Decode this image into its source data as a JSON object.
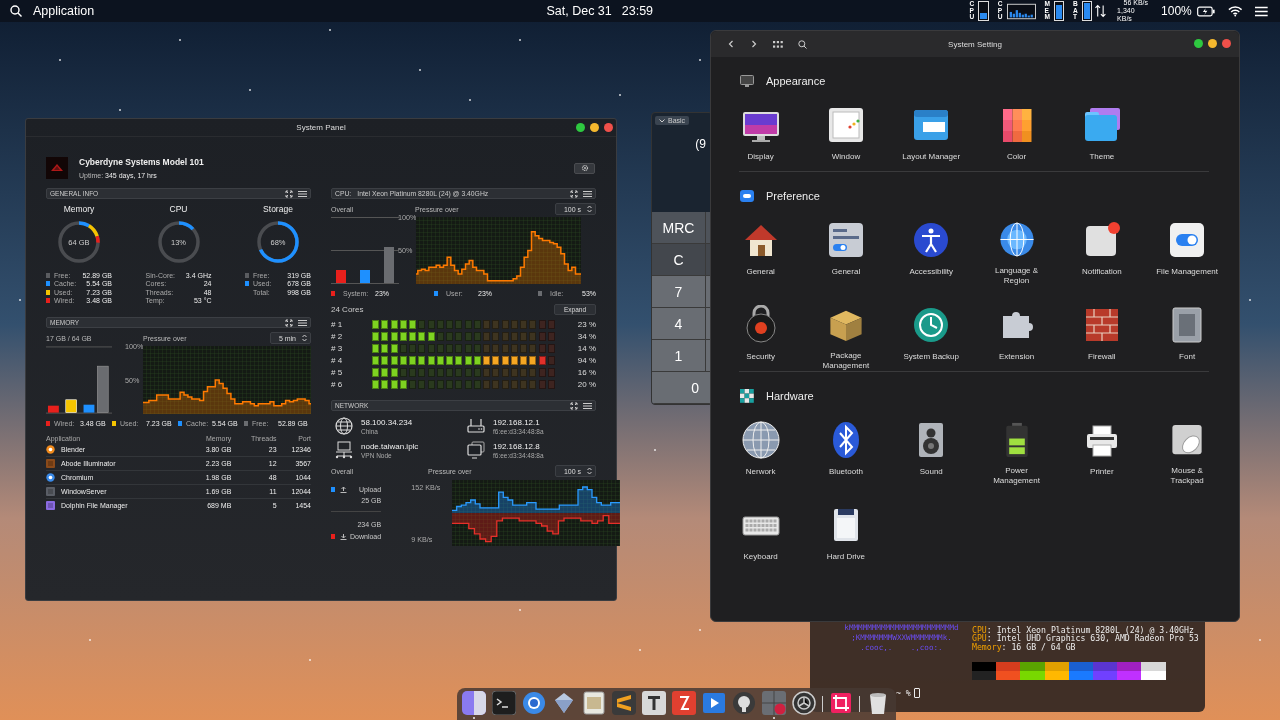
{
  "menu_bar": {
    "app_name": "Application",
    "date": "Sat, Dec 31",
    "time": "23:59",
    "monitors": [
      {
        "label": "CPU",
        "kind": "bar",
        "level": 0.35
      },
      {
        "label": "CPU",
        "kind": "graph"
      },
      {
        "label": "MEM",
        "kind": "bar",
        "level": 0.85
      },
      {
        "label": "BAT",
        "kind": "bar",
        "level": 1
      }
    ],
    "upload_rate": "56 KB/s",
    "download_rate": "1,340 KB/s",
    "battery": "100%"
  },
  "system_panel": {
    "title": "System Panel",
    "machine": "Cyberdyne Systems Model 101",
    "uptime_label": "Uptime:",
    "uptime": "345 days, 17 hrs",
    "general_info": {
      "title": "GENERAL INFO",
      "gauges": [
        {
          "title": "Memory",
          "center": "64 GB",
          "segments": [
            {
              "color": "#1e90ff",
              "level": 0.087
            },
            {
              "color": "#f5c400",
              "level": 0.113
            },
            {
              "color": "#e8201c",
              "level": 0.054
            }
          ],
          "legend": [
            {
              "label": "Free:",
              "value": "52.89 GB",
              "color": "#5a5c60"
            },
            {
              "label": "Cache:",
              "value": "5.54 GB",
              "color": "#1e90ff"
            },
            {
              "label": "Used:",
              "value": "7.23 GB",
              "color": "#f5c400"
            },
            {
              "label": "Wired:",
              "value": "3.48 GB",
              "color": "#e8201c"
            }
          ]
        },
        {
          "title": "CPU",
          "center": "13%",
          "segments": [
            {
              "color": "#1e90ff",
              "level": 0.13
            }
          ],
          "legend": [
            {
              "label": "Sin-Core:",
              "value": "3.4 GHz"
            },
            {
              "label": "Cores:",
              "value": "24"
            },
            {
              "label": "Threads:",
              "value": "48"
            },
            {
              "label": "Temp:",
              "value": "53 °C"
            }
          ]
        },
        {
          "title": "Storage",
          "center": "68%",
          "segments": [
            {
              "color": "#1e90ff",
              "level": 0.68
            }
          ],
          "legend": [
            {
              "label": "Free:",
              "value": "319 GB",
              "color": "#5a5c60"
            },
            {
              "label": "Used:",
              "value": "678 GB",
              "color": "#1e90ff"
            },
            {
              "label": "Total:",
              "value": "998 GB"
            }
          ]
        }
      ]
    },
    "memory": {
      "title": "MEMORY",
      "summary": "17 GB / 64 GB",
      "pressure_label": "Pressure over",
      "range": "5 min",
      "chart_data": {
        "type": "area",
        "ylim": [
          0,
          100
        ],
        "yticks": [
          {
            "value": 50,
            "label": "50%"
          },
          {
            "value": 100,
            "label": "100%"
          }
        ],
        "series": [
          {
            "color": "#ff7a00",
            "values": [
              17,
              17,
              20,
              20,
              28,
              28,
              28,
              22,
              22,
              22,
              32,
              28,
              25,
              22,
              22,
              20,
              33,
              40,
              40,
              50,
              45,
              38,
              30,
              22,
              15,
              15,
              18,
              18,
              15,
              12,
              15,
              15,
              15,
              18,
              12,
              12,
              15,
              20,
              18,
              20,
              22,
              22,
              20,
              15
            ]
          }
        ]
      },
      "legend": [
        {
          "label": "Wired:",
          "value": "3.48 GB",
          "color": "#e8201c"
        },
        {
          "label": "Used:",
          "value": "7.23 GB",
          "color": "#f5c400"
        },
        {
          "label": "Cache:",
          "value": "5.54 GB",
          "color": "#1e90ff"
        },
        {
          "label": "Free:",
          "value": "52.89 GB",
          "color": "#6a6c70"
        }
      ],
      "table": {
        "columns": [
          "Application",
          "Memory",
          "Threads",
          "Port"
        ],
        "rows": [
          [
            "Blender",
            "3.80 GB",
            "23",
            "12346"
          ],
          [
            "Abode Illuminator",
            "2.23 GB",
            "12",
            "3567"
          ],
          [
            "Chromium",
            "1.98 GB",
            "48",
            "1044"
          ],
          [
            "WindowServer",
            "1.69 GB",
            "11",
            "12044"
          ],
          [
            "Dolphin File Manager",
            "689 MB",
            "5",
            "1454"
          ]
        ]
      }
    },
    "cpu": {
      "label": "CPU:",
      "model": "Intel Xeon Platinum 8280L (24) @ 3.40GHz",
      "overall_label": "Overall",
      "pressure_label": "Pressure over",
      "range": "100 s",
      "chart_data": {
        "type": "area",
        "ylim": [
          0,
          100
        ],
        "yticks": [
          {
            "value": 50,
            "label": "50%"
          },
          {
            "value": 100,
            "label": "100%"
          }
        ],
        "series": [
          {
            "color": "#ff7a00",
            "values": [
              15,
              20,
              22,
              20,
              25,
              25,
              28,
              25,
              28,
              40,
              28,
              20,
              15,
              22,
              30,
              35,
              25,
              20,
              20,
              15,
              5,
              5,
              5,
              5,
              5,
              5,
              5,
              8,
              12,
              25,
              40,
              50,
              78,
              72,
              68,
              65,
              65,
              62,
              60,
              55,
              45,
              30,
              20,
              25,
              15,
              15
            ]
          }
        ]
      },
      "legend": [
        {
          "label": "System:",
          "value": "23%",
          "color": "#e8201c"
        },
        {
          "label": "User:",
          "value": "23%",
          "color": "#1e90ff"
        },
        {
          "label": "Idle:",
          "value": "53%",
          "color": "#6a6c70"
        }
      ],
      "cores_title": "24 Cores",
      "expand": "Expand",
      "cores": [
        {
          "label": "# 1",
          "level": 0.23,
          "reading": "23 %"
        },
        {
          "label": "# 2",
          "level": 0.34,
          "reading": "34 %"
        },
        {
          "label": "# 3",
          "level": 0.14,
          "reading": "14 %"
        },
        {
          "label": "# 4",
          "level": 0.94,
          "reading": "94 %"
        },
        {
          "label": "# 5",
          "level": 0.16,
          "reading": "16 %"
        },
        {
          "label": "# 6",
          "level": 0.2,
          "reading": "20 %"
        }
      ]
    },
    "network": {
      "title": "NETWORK",
      "endpoints": [
        {
          "address": "58.100.34.234",
          "detail": "China"
        },
        {
          "address": "192.168.12.1",
          "detail": "f6:ee:d3:34:48:8a"
        },
        {
          "address": "node.taiwan.iplc",
          "detail": "VPN Node"
        },
        {
          "address": "192.168.12.8",
          "detail": "f6:ee:d3:34:48:8a"
        }
      ],
      "overall_label": "Overall",
      "pressure_label": "Pressure over",
      "range": "100 s",
      "upload_label": "Upload",
      "upload_total": "25 GB",
      "download_total": "234 GB",
      "download_label": "Download",
      "top_label": "152 KB/s",
      "bottom_label": "9 KB/s"
    }
  },
  "calculator": {
    "mode": "Basic",
    "display": "(9",
    "keys": [
      {
        "label": "MRC",
        "kind": "memory"
      },
      {
        "label": "C",
        "kind": "function"
      },
      {
        "label": "7",
        "kind": "digit"
      },
      {
        "label": "4",
        "kind": "digit"
      },
      {
        "label": "1",
        "kind": "digit"
      },
      {
        "label": "0",
        "kind": "digit"
      }
    ]
  },
  "system_setting": {
    "title": "System Setting",
    "sections": [
      {
        "title": "Appearance",
        "items": [
          {
            "label": "Display"
          },
          {
            "label": "Window"
          },
          {
            "label": "Layout Manager"
          },
          {
            "label": "Color"
          },
          {
            "label": "Theme"
          }
        ]
      },
      {
        "title": "Preference",
        "items": [
          {
            "label": "General"
          },
          {
            "label": "General"
          },
          {
            "label": "Accessibility"
          },
          {
            "label": "Language & Region"
          },
          {
            "label": "Notification"
          },
          {
            "label": "File Management"
          },
          {
            "label": "Security"
          },
          {
            "label": "Package Management"
          },
          {
            "label": "System Backup"
          },
          {
            "label": "Extension"
          },
          {
            "label": "Firewall"
          },
          {
            "label": "Font"
          }
        ]
      },
      {
        "title": "Hardware",
        "items": [
          {
            "label": "Nerwork"
          },
          {
            "label": "Bluetooth"
          },
          {
            "label": "Sound"
          },
          {
            "label": "Power Management"
          },
          {
            "label": "Printer"
          },
          {
            "label": "Mouse & Trackpad"
          },
          {
            "label": "Keyboard"
          },
          {
            "label": "Hard Drive"
          }
        ]
      }
    ]
  },
  "terminal": {
    "art": [
      "kMMMMMMMMMMMMMMMMMMMMMMMd",
      ";KMMMMMMMWXXWMMMMMMMk.",
      ".cooc,.    .,coo:."
    ],
    "info": [
      {
        "label": "CPU",
        "value": ": Intel Xeon Platinum 8280L (24) @ 3.40GHz"
      },
      {
        "label": "GPU",
        "value": ": Intel UHD Graphics 630, AMD Radeon Pro 53"
      },
      {
        "label": "Memory",
        "value": ": 16 GB / 64 GB"
      }
    ],
    "palette": [
      [
        {
          "color": "#000000"
        },
        {
          "color": "#d63d1e"
        },
        {
          "color": "#5aa400"
        },
        {
          "color": "#e0a000"
        },
        {
          "color": "#1a5fd0"
        },
        {
          "color": "#5a35d0"
        },
        {
          "color": "#a020c0"
        },
        {
          "color": "#d8d8d8"
        }
      ],
      [
        {
          "color": "#222222"
        },
        {
          "color": "#f05020"
        },
        {
          "color": "#78d800"
        },
        {
          "color": "#ffb800"
        },
        {
          "color": "#1a7aff"
        },
        {
          "color": "#7040ff"
        },
        {
          "color": "#c030ff"
        },
        {
          "color": "#ffffff"
        }
      ]
    ],
    "prompt": "~ %"
  },
  "dock": {
    "items": [
      {
        "running": true
      },
      {
        "running": false
      },
      {
        "running": false
      },
      {
        "running": false
      },
      {
        "running": false
      },
      {
        "running": false
      },
      {
        "running": false
      },
      {
        "running": false
      },
      {
        "running": false
      },
      {
        "running": false
      },
      {
        "running": true
      },
      {
        "running": false
      },
      {
        "running": false
      },
      {
        "running": false
      }
    ]
  }
}
